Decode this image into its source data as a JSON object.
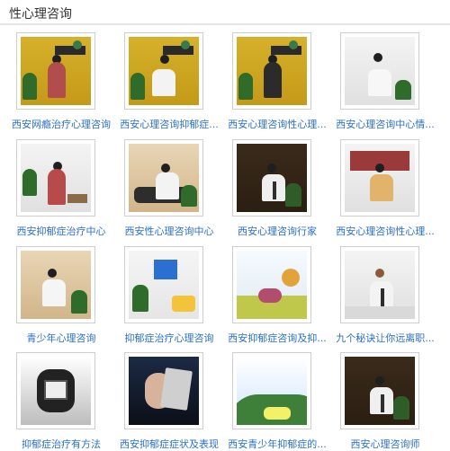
{
  "header": {
    "title": "性心理咨询"
  },
  "items": [
    {
      "caption": "西安网瘾治疗心理咨询"
    },
    {
      "caption": "西安心理咨询抑郁症..."
    },
    {
      "caption": "西安心理咨询性心理..."
    },
    {
      "caption": "西安心理咨询中心情..."
    },
    {
      "caption": "西安抑郁症治疗中心"
    },
    {
      "caption": "西安性心理咨询中心"
    },
    {
      "caption": "西安心理咨询行家"
    },
    {
      "caption": "西安心理咨询性心理..."
    },
    {
      "caption": "青少年心理咨询"
    },
    {
      "caption": "抑郁症治疗心理咨询"
    },
    {
      "caption": "西安抑郁症咨询及抑..."
    },
    {
      "caption": "九个秘诀让你远离职..."
    },
    {
      "caption": "抑郁症治疗有方法"
    },
    {
      "caption": "西安抑郁症症状及表现"
    },
    {
      "caption": "西安青少年抑郁症的..."
    },
    {
      "caption": "西安心理咨询师"
    }
  ]
}
